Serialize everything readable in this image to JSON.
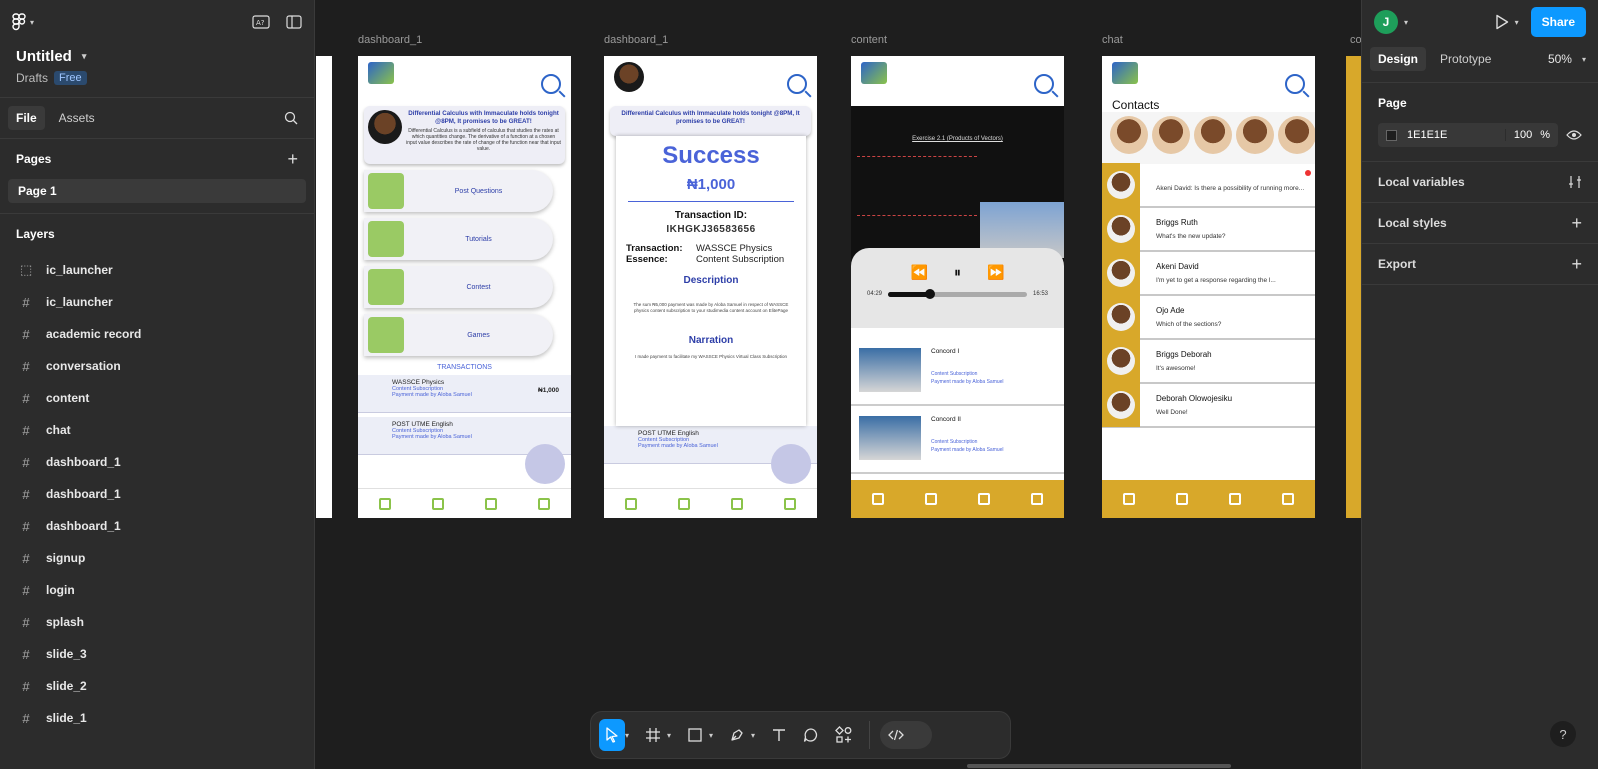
{
  "file": {
    "title": "Untitled",
    "location": "Drafts",
    "plan_badge": "Free"
  },
  "left_tabs": {
    "file": "File",
    "assets": "Assets"
  },
  "pages": {
    "heading": "Pages",
    "items": [
      "Page 1"
    ]
  },
  "layers": {
    "heading": "Layers",
    "items": [
      {
        "name": "ic_launcher",
        "glyph": "⬚"
      },
      {
        "name": "ic_launcher",
        "glyph": "#"
      },
      {
        "name": "academic record",
        "glyph": "#"
      },
      {
        "name": "conversation",
        "glyph": "#"
      },
      {
        "name": "content",
        "glyph": "#"
      },
      {
        "name": "chat",
        "glyph": "#"
      },
      {
        "name": "dashboard_1",
        "glyph": "#"
      },
      {
        "name": "dashboard_1",
        "glyph": "#"
      },
      {
        "name": "dashboard_1",
        "glyph": "#"
      },
      {
        "name": "signup",
        "glyph": "#"
      },
      {
        "name": "login",
        "glyph": "#"
      },
      {
        "name": "splash",
        "glyph": "#"
      },
      {
        "name": "slide_3",
        "glyph": "#"
      },
      {
        "name": "slide_2",
        "glyph": "#"
      },
      {
        "name": "slide_1",
        "glyph": "#"
      }
    ]
  },
  "right_panel": {
    "user_initial": "J",
    "share_label": "Share",
    "tabs": {
      "design": "Design",
      "prototype": "Prototype"
    },
    "zoom": "50%",
    "page_heading": "Page",
    "page_color": "1E1E1E",
    "page_opacity": "100",
    "page_opacity_unit": "%",
    "rows": [
      "Local variables",
      "Local styles",
      "Export"
    ],
    "help": "?"
  },
  "canvas": {
    "frame_labels": [
      "dashboard_1",
      "dashboard_1",
      "content",
      "chat",
      "co"
    ],
    "dashboard": {
      "banner_title": "Differential Calculus with Immaculate holds tonight @8PM, It promises to be GREAT!",
      "banner_body": "Differential Calculus is a subfield of calculus that studies the rates at which quantities change. The derivative of a function at a chosen input value describes the rate of change of the function near that input value.",
      "menu": [
        "Post Questions",
        "Tutorials",
        "Contest",
        "Games"
      ],
      "transactions_label": "TRANSACTIONS",
      "transactions": [
        {
          "title": "WASSCE Physics",
          "sub": "Content Subscription",
          "sub2": "Payment made by Aloba Samuel",
          "amount": "₦1,000"
        },
        {
          "title": "POST UTME English",
          "sub": "Content Subscription",
          "sub2": "Payment made by Aloba Samuel",
          "amount": ""
        }
      ]
    },
    "success": {
      "title": "Success",
      "amount": "₦1,000",
      "tid_label": "Transaction ID:",
      "tid": "IKHGKJ36583656",
      "essence_label": "Transaction: Essence:",
      "essence_value": "WASSCE Physics Content Subscription",
      "description_heading": "Description",
      "description": "The sum ₦5,000 payment was made by Aloba Samuel in respect of WASSCE physics content subscription to your studimedia content account on ElitePage",
      "narration_heading": "Narration",
      "narration": "I made payment to facilitate my WASSCE Physics Virtual Class Subscription"
    },
    "content": {
      "lesson_title": "Exercise 2.1 (Products of Vectors)",
      "controls": [
        "⏪",
        "⏸",
        "⏩"
      ],
      "time_elapsed": "04:29",
      "time_total": "16:53",
      "progress": 0.3,
      "videos": [
        {
          "title": "Concord I",
          "sub": "Content Subscription",
          "sub2": "Payment made by Aloba Samuel"
        },
        {
          "title": "Concord II",
          "sub": "Content Subscription",
          "sub2": "Payment made by Aloba Samuel"
        }
      ]
    },
    "chat": {
      "heading": "Contacts",
      "rows": [
        {
          "name": "",
          "msg": "Akeni David: Is there a possibility of running more..."
        },
        {
          "name": "Briggs Ruth",
          "msg": "What's the new update?"
        },
        {
          "name": "Akeni David",
          "msg": "I'm yet to get a response regarding the l..."
        },
        {
          "name": "Ojo Ade",
          "msg": "Which of the sections?"
        },
        {
          "name": "Briggs Deborah",
          "msg": "It's awesome!"
        },
        {
          "name": "Deborah Olowojesiku",
          "msg": "Well Done!"
        }
      ]
    }
  },
  "colors": {
    "accent": "#0d99ff",
    "panel": "#2c2c2c",
    "canvas": "#1e1e1e",
    "gold": "#d8a82a",
    "brand_blue": "#4a63d8"
  }
}
